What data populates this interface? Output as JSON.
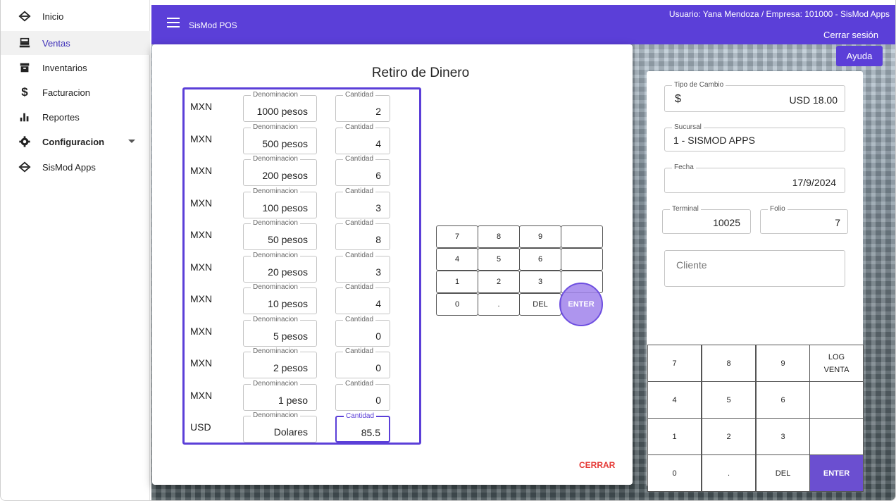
{
  "sidebar": {
    "items": [
      {
        "label": "Inicio",
        "icon": "home-icon"
      },
      {
        "label": "Ventas",
        "icon": "cash-register-icon"
      },
      {
        "label": "Inventarios",
        "icon": "archive-icon"
      },
      {
        "label": "Facturacion",
        "icon": "dollar-icon"
      },
      {
        "label": "Reportes",
        "icon": "bar-chart-icon"
      },
      {
        "label": "Configuracion",
        "icon": "gear-icon"
      },
      {
        "label": "SisMod Apps",
        "icon": "home-icon"
      }
    ]
  },
  "topbar": {
    "app_name": "SisMod POS",
    "user_info": "Usuario: Yana Mendoza / Empresa: 101000 - SisMod Apps",
    "logout_label": "Cerrar sesión",
    "help_label": "Ayuda"
  },
  "dialog": {
    "title": "Retiro de Dinero",
    "denom_label": "Denominacion",
    "qty_label": "Cantidad",
    "rows": [
      {
        "currency": "MXN",
        "denomination": "1000 pesos",
        "quantity": "2"
      },
      {
        "currency": "MXN",
        "denomination": "500 pesos",
        "quantity": "4"
      },
      {
        "currency": "MXN",
        "denomination": "200 pesos",
        "quantity": "6"
      },
      {
        "currency": "MXN",
        "denomination": "100 pesos",
        "quantity": "3"
      },
      {
        "currency": "MXN",
        "denomination": "50 pesos",
        "quantity": "8"
      },
      {
        "currency": "MXN",
        "denomination": "20 pesos",
        "quantity": "3"
      },
      {
        "currency": "MXN",
        "denomination": "10 pesos",
        "quantity": "4"
      },
      {
        "currency": "MXN",
        "denomination": "5 pesos",
        "quantity": "0"
      },
      {
        "currency": "MXN",
        "denomination": "2 pesos",
        "quantity": "0"
      },
      {
        "currency": "MXN",
        "denomination": "1 peso",
        "quantity": "0"
      },
      {
        "currency": "USD",
        "denomination": "Dolares",
        "quantity": "85.5"
      }
    ],
    "keypad": {
      "k7": "7",
      "k8": "8",
      "k9": "9",
      "k4": "4",
      "k5": "5",
      "k6": "6",
      "k1": "1",
      "k2": "2",
      "k3": "3",
      "k0": "0",
      "dot": ".",
      "del": "DEL",
      "enter": "ENTER"
    },
    "close_label": "CERRAR"
  },
  "right_panel": {
    "exchange_label": "Tipo de Cambio",
    "exchange_symbol": "$",
    "exchange_value": "USD  18.00",
    "branch_label": "Sucursal",
    "branch_value": "1 - SISMOD APPS",
    "date_label": "Fecha",
    "date_value": "17/9/2024",
    "terminal_label": "Terminal",
    "terminal_value": "10025",
    "folio_label": "Folio",
    "folio_value": "7",
    "client_placeholder": "Cliente",
    "keypad": {
      "k7": "7",
      "k8": "8",
      "k9": "9",
      "log1": "LOG",
      "log2": "VENTA",
      "k4": "4",
      "k5": "5",
      "k6": "6",
      "k1": "1",
      "k2": "2",
      "k3": "3",
      "k0": "0",
      "dot": ".",
      "del": "DEL",
      "enter": "ENTER"
    }
  },
  "colors": {
    "accent": "#5b3fd8",
    "danger": "#e53935"
  }
}
